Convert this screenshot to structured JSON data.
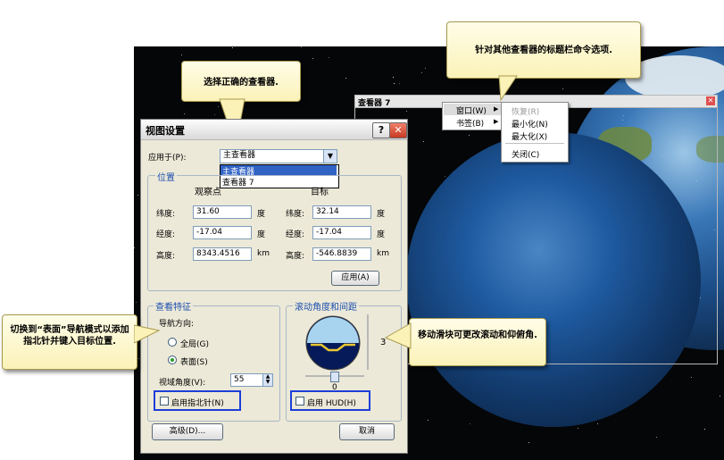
{
  "callouts": {
    "select_viewer": "选择正确的查看器.",
    "titlebar_options": "针对其他查看器的标题栏命令选项.",
    "surface_mode": "切换到“表面”导航模式以添加指北针并键入目标位置.",
    "slider": "移动滑块可更改滚动和仰俯角."
  },
  "viewer7": {
    "title": "查看器 7",
    "close": "✕"
  },
  "context_menu": {
    "items": [
      "窗口(W)",
      "书签(B)"
    ],
    "submenu": [
      "恢复(R)",
      "最小化(N)",
      "最大化(X)",
      "关闭(C)"
    ]
  },
  "dialog": {
    "title": "视图设置",
    "help_btn": "?",
    "close_btn": "✕",
    "apply_to_label": "应用于(P):",
    "apply_to_value": "主查看器",
    "dropdown_options": [
      "主查看器",
      "查看器 7"
    ],
    "position_group": "位置",
    "observer_header": "观察点",
    "target_header": "目标",
    "lat_label": "纬度:",
    "lon_label": "经度:",
    "alt_label": "高度:",
    "obs_lat": "31.60",
    "obs_lon": "-17.04",
    "obs_alt": "8343.4516",
    "tgt_lat": "32.14",
    "tgt_lon": "-17.04",
    "tgt_alt": "-546.8839",
    "unit_deg": "度",
    "unit_km": "km",
    "apply_btn": "应用(A)",
    "view_features_group": "查看特征",
    "nav_dir_label": "导航方向:",
    "radio_global": "全局(G)",
    "radio_surface": "表面(S)",
    "fov_label": "视域角度(V):",
    "fov_value": "55",
    "north_arrow_label": "启用指北针(N)",
    "roll_group": "滚动角度和间距",
    "pitch_tick": "3",
    "roll_value": "0",
    "hud_label": "启用 HUD(H)",
    "advanced_btn": "高级(D)...",
    "cancel_btn": "取消"
  },
  "colors": {
    "accent": "#1c3fd8",
    "group_label": "#1d4fb0"
  }
}
